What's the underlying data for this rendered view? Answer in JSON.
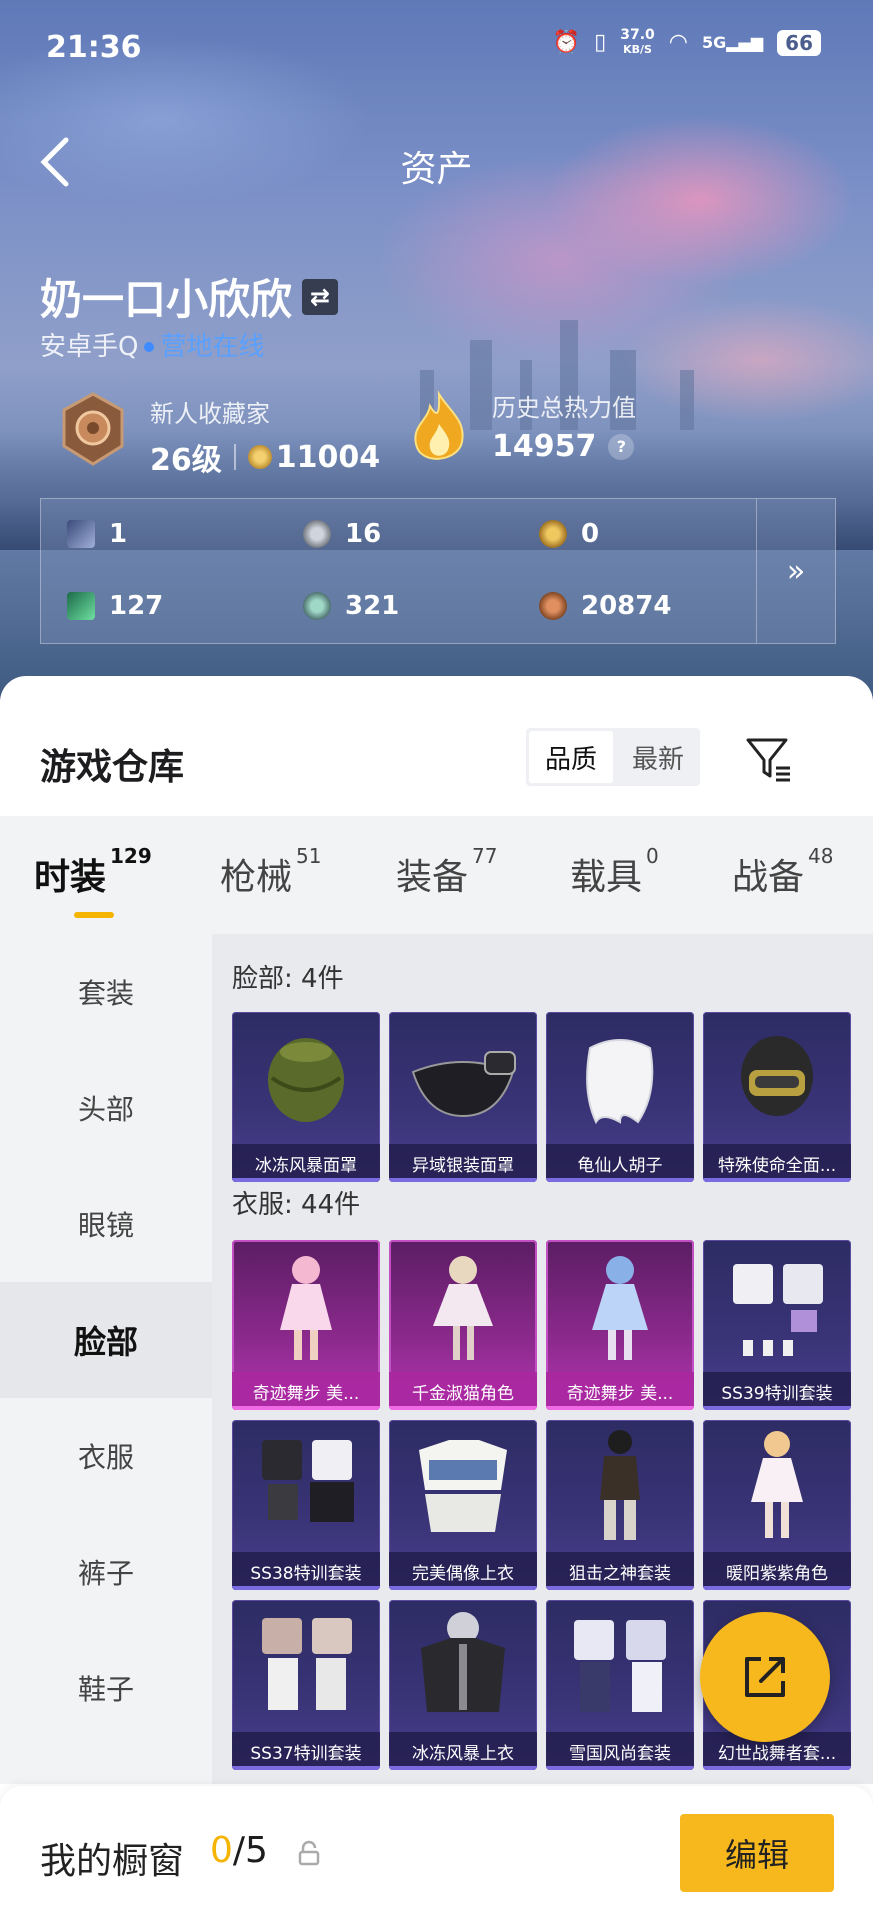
{
  "status_bar": {
    "time": "21:36",
    "speed_top": "37.0",
    "speed_unit": "KB/S",
    "network": "5G",
    "battery": "66"
  },
  "header": {
    "title": "资产"
  },
  "profile": {
    "name": "奶一口小欣欣",
    "platform": "安卓手Q",
    "online_status": "营地在线",
    "collector_label": "新人收藏家",
    "level": "26级",
    "coins": "11004",
    "heat_label": "历史总热力值",
    "heat_value": "14957",
    "help_icon": "?"
  },
  "currency": [
    {
      "icon": "card-icon",
      "value": "1"
    },
    {
      "icon": "silver-coin-icon",
      "value": "16"
    },
    {
      "icon": "gold-token-icon",
      "value": "0"
    },
    {
      "icon": "green-card-icon",
      "value": "127"
    },
    {
      "icon": "teal-coin-icon",
      "value": "321"
    },
    {
      "icon": "bronze-coin-icon",
      "value": "20874"
    }
  ],
  "warehouse": {
    "title": "游戏仓库",
    "sort_options": [
      "品质",
      "最新"
    ],
    "sort_selected": "品质"
  },
  "tabs": [
    {
      "label": "时装",
      "count": "129"
    },
    {
      "label": "枪械",
      "count": "51"
    },
    {
      "label": "装备",
      "count": "77"
    },
    {
      "label": "载具",
      "count": "0"
    },
    {
      "label": "战备",
      "count": "48"
    }
  ],
  "sidebar": [
    "套装",
    "头部",
    "眼镜",
    "脸部",
    "衣服",
    "裤子",
    "鞋子"
  ],
  "sidebar_selected": "脸部",
  "sections": [
    {
      "title": "脸部: 4件",
      "items": [
        "冰冻风暴面罩",
        "异域银装面罩",
        "龟仙人胡子",
        "特殊使命全面..."
      ]
    },
    {
      "title": "衣服: 44件",
      "items": [
        "奇迹舞步 美...",
        "千金淑猫角色",
        "奇迹舞步 美...",
        "SS39特训套装",
        "SS38特训套装",
        "完美偶像上衣",
        "狙击之神套装",
        "暖阳紫紫角色",
        "SS37特训套装",
        "冰冻风暴上衣",
        "雪国风尚套装",
        "幻世战舞者套..."
      ]
    }
  ],
  "showcase": {
    "label": "我的橱窗",
    "current": "0",
    "total": "/5",
    "edit_button": "编辑"
  },
  "colors": {
    "accent": "#f6b81c",
    "online": "#3e8cff",
    "pink_rarity": "#b537b1",
    "purple_rarity": "#3a3478"
  }
}
